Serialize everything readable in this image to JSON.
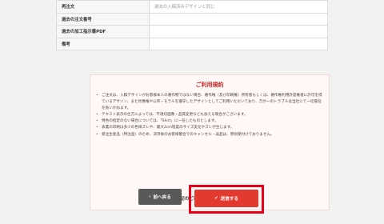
{
  "order_rows": [
    {
      "label": "再注文",
      "value": "過去の入稿済みデザインと同じ"
    },
    {
      "label": "過去の注文番号",
      "value": ""
    },
    {
      "label": "過去の加工指示書PDF",
      "value": ""
    },
    {
      "label": "備考",
      "value": ""
    }
  ],
  "terms": {
    "title": "ご利用規約",
    "items": [
      "ご注文は、入稿デザインがお客様本人の著作物ではない場合、著作権（及び印刷権）所有者もしくは、著作権利用許諾権者に許可を得ているデザイン、また肖像権や公序・モラルを遵守したデザインとしてご利用いただいており、万が一のトラブルは当社にて一切責任を負いかねます。",
      "テキスト表示の仕方によっては、不適切画像・品質変更なども加える場合がございます。",
      "特色の指定のない場合については、「Shirt」に一任したものとします。",
      "表裏の印刷は多少の色味ズレや、最大2cm程度のサイズ変化やズレが生じます。",
      "受注生産品（特注品）のため、決済後のお客様都合でのキャンセル・返品は、原則受付けておりません。"
    ],
    "agree_label": "上記のご利用規約に同意する",
    "agree_checked": "✔"
  },
  "buttons": {
    "back_label": "前へ戻る",
    "back_icon": "‹",
    "submit_label": "送信する",
    "submit_icon": "✔"
  }
}
